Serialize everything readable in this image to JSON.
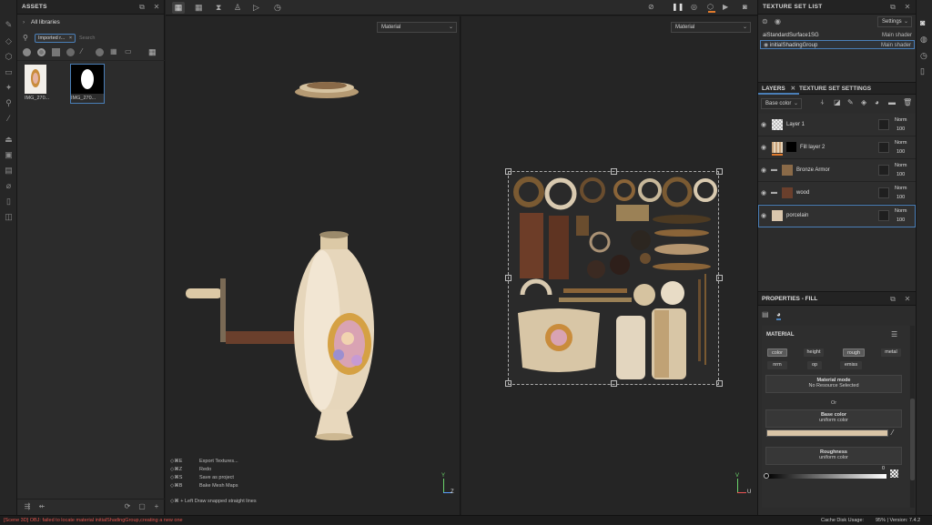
{
  "top_toolbar": {
    "left_icons": [
      "grid-view-icon",
      "grid-dense-icon",
      "symmetry-icon",
      "figure-icon",
      "play-box-icon",
      "history-icon"
    ],
    "right_icons": [
      "fx-icon",
      "pause-icon",
      "camera-settings-icon",
      "cube-icon",
      "video-icon",
      "screenshot-icon"
    ]
  },
  "assets": {
    "title": "ASSETS",
    "breadcrumb": "All libraries",
    "filter_chip": "Imported r...",
    "search_placeholder": "Search",
    "thumbs": [
      {
        "label": "IMG_270..."
      },
      {
        "label": "IMG_270..."
      }
    ]
  },
  "viewport3d": {
    "dropdown": "Material",
    "shortcuts": [
      {
        "keys": "◇⌘E",
        "action": "Export Textures..."
      },
      {
        "keys": "◇⌘Z",
        "action": "Redo"
      },
      {
        "keys": "◇⌘S",
        "action": "Save as project"
      },
      {
        "keys": "◇⌘B",
        "action": "Bake Mesh Maps"
      }
    ],
    "hint": "◇⌘ + Left  Draw snapped straight lines",
    "axis_y": "Y",
    "axis_z": "Z"
  },
  "viewport2d": {
    "dropdown": "Material",
    "axis_v": "V",
    "axis_u": "U"
  },
  "texture_set_list": {
    "title": "TEXTURE SET LIST",
    "settings_label": "Settings",
    "rows": [
      {
        "name": "aiStandardSurface1SG",
        "shader": "Main shader"
      },
      {
        "name": "initialShadingGroup",
        "shader": "Main shader"
      }
    ]
  },
  "layers_panel": {
    "tab_layers": "LAYERS",
    "tab_settings": "TEXTURE SET SETTINGS",
    "channel_dropdown": "Base color",
    "layers": [
      {
        "name": "Layer 1",
        "blend": "Norm",
        "opacity": "100",
        "thumb_color": "#d8d8d8"
      },
      {
        "name": "Fill layer 2",
        "blend": "Norm",
        "opacity": "100",
        "thumb_color": "#c8a27a"
      },
      {
        "name": "Bronze Armor",
        "blend": "Norm",
        "opacity": "100",
        "thumb_color": "#8a6a48"
      },
      {
        "name": "wood",
        "blend": "Norm",
        "opacity": "100",
        "thumb_color": "#6a3f2c"
      },
      {
        "name": "porcelain",
        "blend": "Norm",
        "opacity": "100",
        "thumb_color": "#d9c6ad"
      }
    ]
  },
  "properties": {
    "title": "PROPERTIES - FILL",
    "section": "MATERIAL",
    "channels": [
      "color",
      "height",
      "rough",
      "metal",
      "nrm",
      "op",
      "emiss"
    ],
    "material_mode_label": "Material mode",
    "material_mode_value": "No Resource Selected",
    "or_label": "Or",
    "base_color_label": "Base color",
    "base_color_sub": "uniform color",
    "base_color_hex": "#d9c4a6",
    "roughness_label": "Roughness",
    "roughness_sub": "uniform color",
    "roughness_value": "0"
  },
  "status": {
    "message": "[Scene 3D] OBJ: failed to locate material initialShadingGroup,creating a new one",
    "cache_label": "Cache Disk Usage:",
    "cache_value": "95% | Version: 7.4.2"
  }
}
